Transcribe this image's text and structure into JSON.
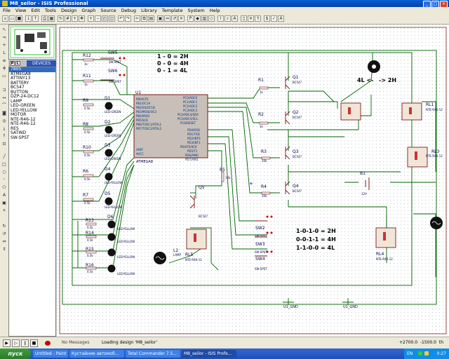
{
  "window": {
    "title": "M8_seilor - ISIS Professional"
  },
  "menu": [
    "File",
    "View",
    "Edit",
    "Tools",
    "Design",
    "Graph",
    "Source",
    "Debug",
    "Library",
    "Template",
    "System",
    "Help"
  ],
  "devices": {
    "tab_p": "P",
    "tab_l": "L",
    "label": "DEVICES",
    "items": [
      "7805",
      "ATMEGA8",
      "ATTINY13",
      "BATTERY",
      "BC547",
      "BUTTON",
      "DZP-24-DC12",
      "LAMP",
      "LED-GREEN",
      "LED-YELLOW",
      "MOTOR",
      "NTE-R46-12",
      "NTE-R46-12",
      "RES",
      "SATIND",
      "SW-SPST"
    ],
    "selected_index": 0
  },
  "schematic": {
    "notes_top": [
      "1 - 0 = 2H",
      "0 - 0 = 4H",
      "0 - 1 = 4L"
    ],
    "notes_mid": [
      "1-0-1-0 = 2H",
      "0-0-1-1 = 4H",
      "1-1-0-0 = 4L"
    ],
    "motor_left": "4L <-",
    "motor_right": "-> 2H",
    "mcu": {
      "ref": "U1",
      "part": "ATMEGA8",
      "left_pins": [
        "PB0/ICP1",
        "PB1/OC1A",
        "PB2/SS/OC1B",
        "PB3/MOSI/OC2",
        "PB4/MISO",
        "PB5/SCK",
        "PB6/TOSC1/XTAL1",
        "PB7/TOSC2/XTAL2",
        "",
        "AREF",
        "AVCC"
      ],
      "right_pins": [
        "PC0/ADC0",
        "PC1/ADC1",
        "PC2/ADC2",
        "PC3/ADC3",
        "PC4/ADC4/SDA",
        "PC5/ADC5/SCL",
        "PC6/RESET",
        "",
        "PD0/RXD",
        "PD1/TXD",
        "PD2/INT0",
        "PD3/INT1",
        "PD4/T0/XCK",
        "PD5/T1",
        "PD6/AIN0",
        "PD7/AIN1"
      ]
    },
    "switches": [
      "SW5",
      "SW6",
      "SW2",
      "SW3",
      "SW4"
    ],
    "sw_part": "SW-SPST",
    "leds": [
      {
        "ref": "D1",
        "part": "LED-GREEN"
      },
      {
        "ref": "D2",
        "part": "LED-GREEN"
      },
      {
        "ref": "D3",
        "part": "LED-GREEN"
      },
      {
        "ref": "D4",
        "part": "LED-YELLOW"
      },
      {
        "ref": "D5",
        "part": "LED-YELLOW"
      },
      {
        "ref": "D6",
        "part": "LED-YELLOW"
      },
      {
        "ref": "D7",
        "part": "LED-YELLOW"
      },
      {
        "ref": "D8",
        "part": "LED-YELLOW"
      },
      {
        "ref": "D9",
        "part": "LED-YELLOW"
      }
    ],
    "left_resistors": [
      "R12",
      "R11",
      "R9",
      "R8",
      "R10",
      "R6",
      "R7",
      "R13",
      "R14",
      "R15",
      "R16"
    ],
    "res_values": [
      "1k",
      "1k",
      "0.5k",
      "0.5k",
      "0.5k",
      "0.5k",
      "0.5k",
      "0.5k",
      "0.5k",
      "0.5k",
      "0.5k"
    ],
    "base_resistors": [
      "R1",
      "R2",
      "R3",
      "R4",
      "R5"
    ],
    "base_values": [
      "1k",
      "1k",
      "10k",
      "10k",
      "10k"
    ],
    "transistors": [
      "Q1",
      "Q2",
      "Q3",
      "Q4",
      "Q5"
    ],
    "transistor_part": "BC547",
    "relays": [
      "RL1",
      "RL2",
      "RL3",
      "RL4",
      "RL5"
    ],
    "relay_part": "NTE-R46-12",
    "battery": {
      "ref": "B1",
      "value": "12V"
    },
    "lamp": "L2",
    "lamp_part": "LAMP",
    "grounds": [
      "U1_GND",
      "U1_GND"
    ],
    "text_tag": "<TEXT>"
  },
  "status": {
    "messages": "No Messages",
    "text": "Loading design 'M8_seilor'",
    "coord_x": "+2700.0",
    "coord_y": "-1500.0",
    "units": "th"
  },
  "taskbar": {
    "start": "пуск",
    "tasks": [
      "Untitled - Paint",
      "Кустайние автомоб...",
      "Total Commander 7.5...",
      "M8_seilor - ISIS Profe..."
    ],
    "lang": "EN",
    "time": "0:27"
  },
  "colors": {
    "wire": "#006400",
    "body": "#7d1a1a",
    "pin_text": "#003080",
    "ref_text": "#00004a"
  }
}
